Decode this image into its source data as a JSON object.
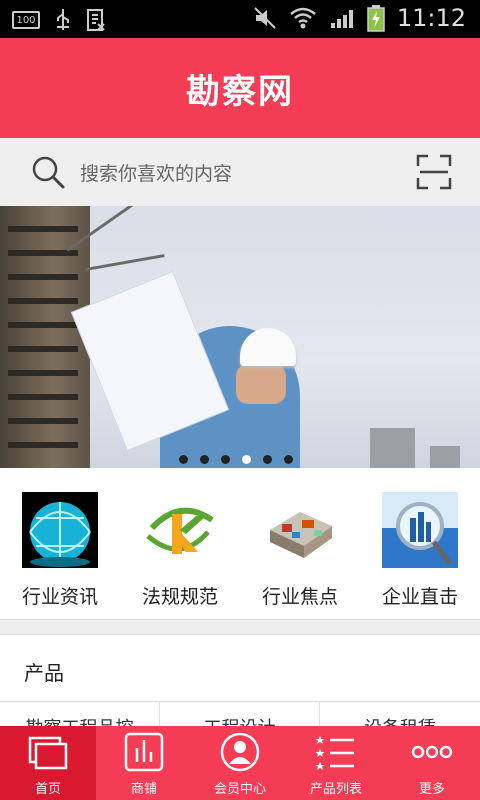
{
  "status_bar": {
    "time": "11:12",
    "left_badge": "100"
  },
  "header": {
    "title": "勘察网",
    "brand_color": "#f43c55"
  },
  "search": {
    "placeholder": "搜索你喜欢的内容"
  },
  "banner": {
    "slide_count": 6,
    "active_slide": 4
  },
  "categories": [
    {
      "label": "行业资讯",
      "icon": "globe-icon"
    },
    {
      "label": "法规规范",
      "icon": "k-logo-icon"
    },
    {
      "label": "行业焦点",
      "icon": "house-model-icon"
    },
    {
      "label": "企业直击",
      "icon": "magnifier-city-icon"
    }
  ],
  "section": {
    "title": "产品"
  },
  "subtabs": [
    "勘察工程品控",
    "工程设计",
    "设备租赁"
  ],
  "tabbar": [
    {
      "label": "首页",
      "icon": "home-icon",
      "active": true
    },
    {
      "label": "商铺",
      "icon": "shop-chart-icon",
      "active": false
    },
    {
      "label": "会员中心",
      "icon": "member-icon",
      "active": false
    },
    {
      "label": "产品列表",
      "icon": "list-icon",
      "active": false
    },
    {
      "label": "更多",
      "icon": "more-icon",
      "active": false
    }
  ]
}
